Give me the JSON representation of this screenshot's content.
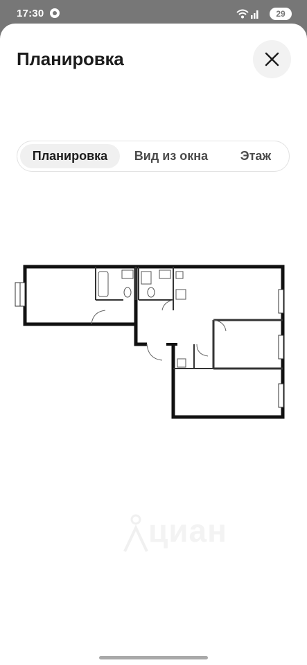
{
  "status_bar": {
    "time": "17:30",
    "battery": "29",
    "icons": [
      "app-notification-icon",
      "wifi-icon",
      "signal-icon",
      "battery-icon"
    ]
  },
  "sheet": {
    "title": "Планировка",
    "close_icon": "close-icon"
  },
  "tabs": [
    {
      "label": "Планировка",
      "active": true
    },
    {
      "label": "Вид из окна",
      "active": false
    },
    {
      "label": "Этаж",
      "active": false
    }
  ],
  "floorplan": {
    "image": "apartment-floor-plan",
    "watermark": "циан"
  },
  "colors": {
    "overlay": "#777777",
    "sheet": "#ffffff",
    "active_tab": "#f0f0f0",
    "text": "#1c1c1c"
  }
}
